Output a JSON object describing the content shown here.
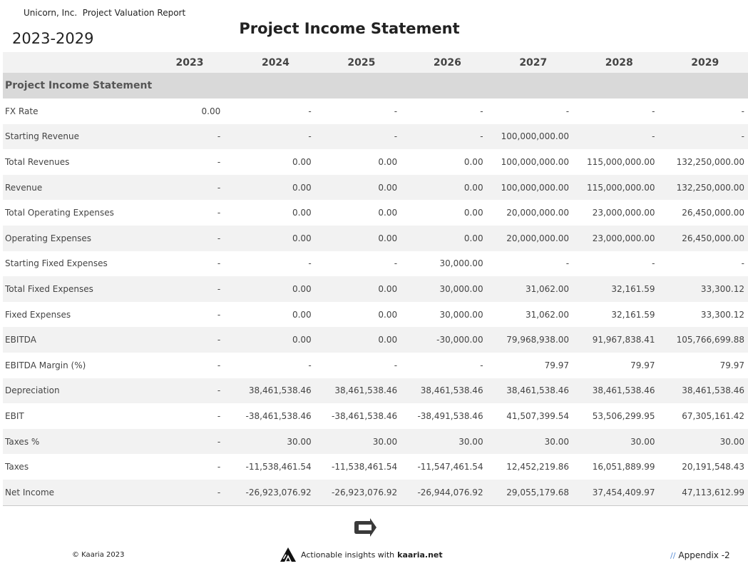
{
  "header": {
    "report_name": "Unicorn, Inc.  Project Valuation Report",
    "period": "2023-2029",
    "title": "Project Income Statement"
  },
  "table": {
    "columns": [
      "",
      "2023",
      "2024",
      "2025",
      "2026",
      "2027",
      "2028",
      "2029"
    ],
    "section_title": "Project Income Statement",
    "rows": [
      {
        "label": "FX Rate",
        "values": [
          "0.00",
          "-",
          "-",
          "-",
          "-",
          "-",
          "-"
        ]
      },
      {
        "label": "Starting Revenue",
        "values": [
          "-",
          "-",
          "-",
          "-",
          "100,000,000.00",
          "-",
          "-"
        ]
      },
      {
        "label": "Total Revenues",
        "values": [
          "-",
          "0.00",
          "0.00",
          "0.00",
          "100,000,000.00",
          "115,000,000.00",
          "132,250,000.00"
        ]
      },
      {
        "label": "Revenue",
        "values": [
          "-",
          "0.00",
          "0.00",
          "0.00",
          "100,000,000.00",
          "115,000,000.00",
          "132,250,000.00"
        ]
      },
      {
        "label": "Total Operating Expenses",
        "values": [
          "-",
          "0.00",
          "0.00",
          "0.00",
          "20,000,000.00",
          "23,000,000.00",
          "26,450,000.00"
        ]
      },
      {
        "label": "Operating Expenses",
        "values": [
          "-",
          "0.00",
          "0.00",
          "0.00",
          "20,000,000.00",
          "23,000,000.00",
          "26,450,000.00"
        ]
      },
      {
        "label": "Starting Fixed Expenses",
        "values": [
          "-",
          "-",
          "-",
          "30,000.00",
          "-",
          "-",
          "-"
        ]
      },
      {
        "label": "Total Fixed Expenses",
        "values": [
          "-",
          "0.00",
          "0.00",
          "30,000.00",
          "31,062.00",
          "32,161.59",
          "33,300.12"
        ]
      },
      {
        "label": "Fixed Expenses",
        "values": [
          "-",
          "0.00",
          "0.00",
          "30,000.00",
          "31,062.00",
          "32,161.59",
          "33,300.12"
        ]
      },
      {
        "label": "EBITDA",
        "values": [
          "-",
          "0.00",
          "0.00",
          "-30,000.00",
          "79,968,938.00",
          "91,967,838.41",
          "105,766,699.88"
        ]
      },
      {
        "label": "EBITDA Margin (%)",
        "values": [
          "-",
          "-",
          "-",
          "-",
          "79.97",
          "79.97",
          "79.97"
        ]
      },
      {
        "label": "Depreciation",
        "values": [
          "-",
          "38,461,538.46",
          "38,461,538.46",
          "38,461,538.46",
          "38,461,538.46",
          "38,461,538.46",
          "38,461,538.46"
        ]
      },
      {
        "label": "EBIT",
        "values": [
          "-",
          "-38,461,538.46",
          "-38,461,538.46",
          "-38,491,538.46",
          "41,507,399.54",
          "53,506,299.95",
          "67,305,161.42"
        ]
      },
      {
        "label": "Taxes %",
        "values": [
          "-",
          "30.00",
          "30.00",
          "30.00",
          "30.00",
          "30.00",
          "30.00"
        ]
      },
      {
        "label": "Taxes",
        "values": [
          "-",
          "-11,538,461.54",
          "-11,538,461.54",
          "-11,547,461.54",
          "12,452,219.86",
          "16,051,889.99",
          "20,191,548.43"
        ]
      },
      {
        "label": "Net Income",
        "values": [
          "-",
          "-26,923,076.92",
          "-26,923,076.92",
          "-26,944,076.92",
          "29,055,179.68",
          "37,454,409.97",
          "47,113,612.99"
        ]
      }
    ]
  },
  "footer": {
    "copyright": "© Kaaria 2023",
    "tagline": "Actionable insights with",
    "brand": "kaaria.net",
    "appendix_slashes": "//",
    "appendix": "Appendix -2",
    "logo_icon": "kaaria-logo-icon",
    "app_icon": "arrow-logo-icon"
  },
  "colors": {
    "header_bg": "#f2f2f2",
    "section_bg": "#d9d9d9",
    "zebra_bg": "#f2f2f2",
    "accent": "#5b8fd6"
  }
}
